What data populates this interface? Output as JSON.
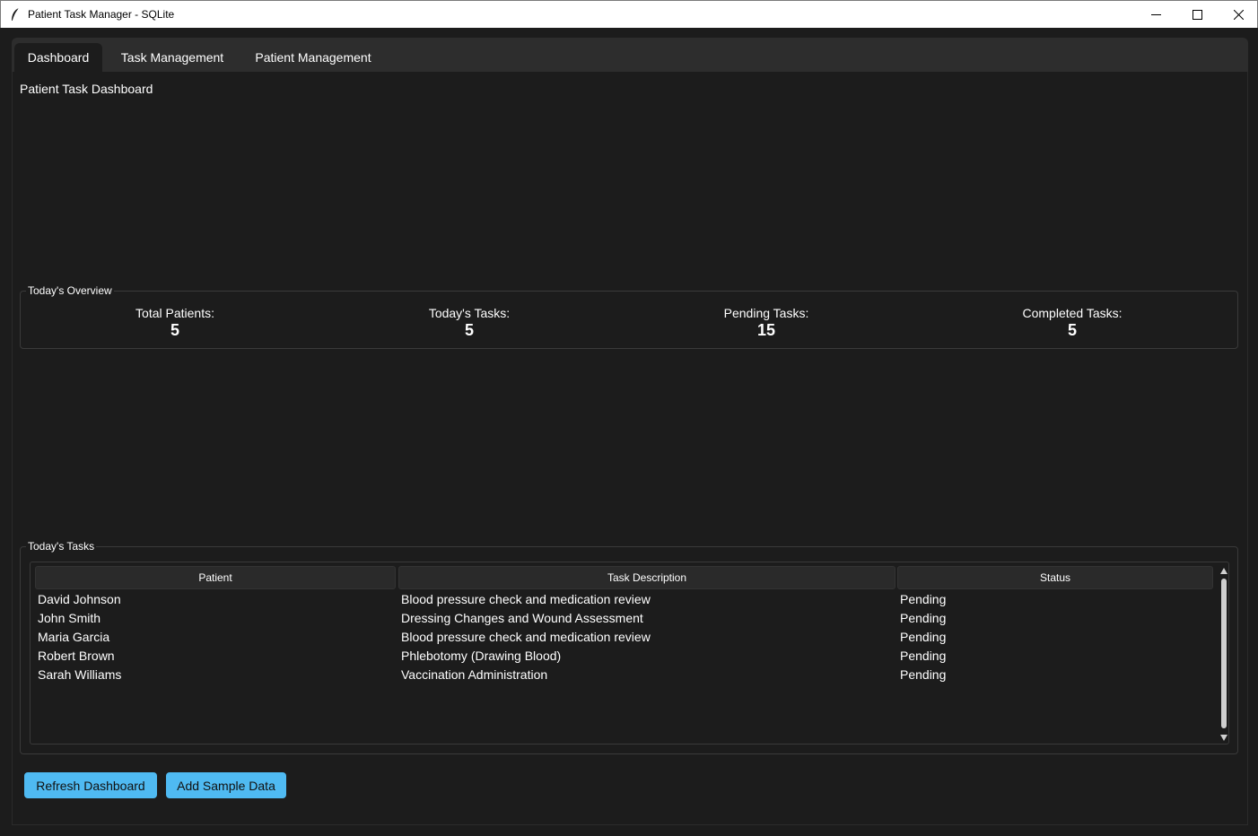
{
  "window": {
    "title": "Patient Task Manager - SQLite",
    "icon": "feather-icon"
  },
  "tabs": [
    {
      "label": "Dashboard",
      "active": true
    },
    {
      "label": "Task Management",
      "active": false
    },
    {
      "label": "Patient Management",
      "active": false
    }
  ],
  "dashboard": {
    "title": "Patient Task Dashboard",
    "overview": {
      "label": "Today's Overview",
      "stats": [
        {
          "label": "Total Patients:",
          "value": "5"
        },
        {
          "label": "Today's Tasks:",
          "value": "5"
        },
        {
          "label": "Pending Tasks:",
          "value": "15"
        },
        {
          "label": "Completed Tasks:",
          "value": "5"
        }
      ]
    },
    "tasks": {
      "label": "Today's Tasks",
      "columns": [
        "Patient",
        "Task Description",
        "Status"
      ],
      "rows": [
        {
          "patient": "David Johnson",
          "task": "Blood pressure check and medication review",
          "status": "Pending"
        },
        {
          "patient": "John Smith",
          "task": "Dressing Changes and Wound Assessment",
          "status": "Pending"
        },
        {
          "patient": "Maria Garcia",
          "task": "Blood pressure check and medication review",
          "status": "Pending"
        },
        {
          "patient": "Robert Brown",
          "task": "Phlebotomy (Drawing Blood)",
          "status": "Pending"
        },
        {
          "patient": "Sarah Williams",
          "task": "Vaccination Administration",
          "status": "Pending"
        }
      ]
    },
    "buttons": {
      "refresh": "Refresh Dashboard",
      "sample": "Add Sample Data"
    }
  },
  "colors": {
    "background": "#1c1c1c",
    "tab_bar": "#2d2d2d",
    "accent": "#4fbaf2",
    "header": "#2a2a2a"
  }
}
